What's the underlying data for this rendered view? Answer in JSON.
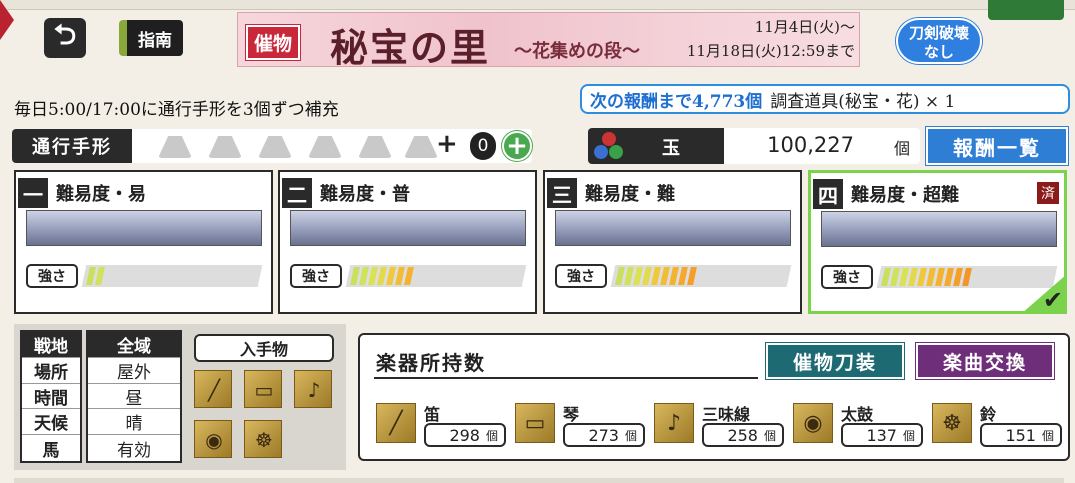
{
  "header": {
    "back_icon": "back-arrow-icon",
    "guide_label": "指南",
    "destroy_label": "刀剣破壊\nなし"
  },
  "banner": {
    "tag": "催物",
    "title": "秘宝の里",
    "subtitle": "～花集めの段～",
    "start": "11月4日(火)～",
    "end": "11月18日(火)12:59まで"
  },
  "refill_text": "毎日5:00/17:00に通行手形を3個ずつ補充",
  "next_reward": {
    "highlight": "次の報酬まで4,773個",
    "item": "調査道具(秘宝・花) × 1"
  },
  "pass": {
    "label": "通行手形",
    "slots": 6,
    "filled": 0,
    "plus": "+",
    "count": "0"
  },
  "gem": {
    "label": "玉",
    "value": "100,227",
    "unit": "個"
  },
  "reward_list_label": "報酬一覧",
  "difficulties": [
    {
      "num": "一",
      "name": "難易度・易",
      "strength_label": "強さ",
      "level": 2,
      "done": false,
      "selected": false
    },
    {
      "num": "二",
      "name": "難易度・普",
      "strength_label": "強さ",
      "level": 7,
      "done": false,
      "selected": false
    },
    {
      "num": "三",
      "name": "難易度・難",
      "strength_label": "強さ",
      "level": 9,
      "done": false,
      "selected": false
    },
    {
      "num": "四",
      "name": "難易度・超難",
      "strength_label": "強さ",
      "level": 10,
      "done": true,
      "done_label": "済",
      "selected": true
    }
  ],
  "conditions": {
    "labels": [
      "戦地",
      "場所",
      "時間",
      "天候",
      "馬"
    ],
    "values": [
      "全域",
      "屋外",
      "昼",
      "晴",
      "有効"
    ]
  },
  "obtain": {
    "header": "入手物",
    "icons": [
      "flute-icon",
      "koto-icon",
      "shamisen-icon",
      "drum-icon",
      "bell-icon"
    ]
  },
  "instruments": {
    "title": "楽器所持数",
    "equip_label": "催物刀装",
    "exchange_label": "楽曲交換",
    "unit": "個",
    "items": [
      {
        "name": "笛",
        "count": "298",
        "icon": "flute-icon"
      },
      {
        "name": "琴",
        "count": "273",
        "icon": "koto-icon"
      },
      {
        "name": "三味線",
        "count": "258",
        "icon": "shamisen-icon"
      },
      {
        "name": "太鼓",
        "count": "137",
        "icon": "drum-icon"
      },
      {
        "name": "鈴",
        "count": "151",
        "icon": "bell-icon"
      }
    ]
  },
  "colors": {
    "accent_blue": "#2f7ed6",
    "select_green": "#7bd24d",
    "done_red": "#8b1a1a"
  }
}
